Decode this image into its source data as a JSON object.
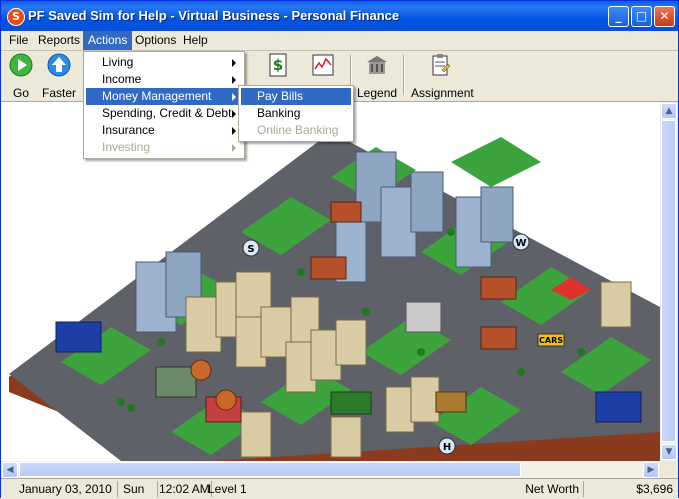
{
  "window": {
    "title": "PF Saved Sim for Help - Virtual Business - Personal Finance",
    "icon_letter": "S"
  },
  "menubar": [
    "File",
    "Reports",
    "Actions",
    "Options",
    "Help"
  ],
  "toolbar": {
    "go": "Go",
    "faster": "Faster",
    "legend": "Legend",
    "assignment": "Assignment"
  },
  "actions_menu": [
    {
      "label": "Living",
      "submenu": true,
      "enabled": true
    },
    {
      "label": "Income",
      "submenu": true,
      "enabled": true
    },
    {
      "label": "Money Management",
      "submenu": true,
      "enabled": true
    },
    {
      "label": "Spending, Credit & Debt",
      "submenu": true,
      "enabled": true
    },
    {
      "label": "Insurance",
      "submenu": true,
      "enabled": true
    },
    {
      "label": "Investing",
      "submenu": true,
      "enabled": false
    }
  ],
  "money_submenu": [
    {
      "label": "Pay Bills",
      "enabled": true
    },
    {
      "label": "Banking",
      "enabled": true
    },
    {
      "label": "Online Banking",
      "enabled": false
    }
  ],
  "map_markers": {
    "s": "S",
    "w": "W",
    "h": "H",
    "cars": "CARS"
  },
  "status": {
    "date": "January 03, 2010",
    "day": "Sun",
    "time": "12:02 AM",
    "level": "Level 1",
    "networth_label": "Net Worth",
    "networth_value": "$3,696"
  },
  "colors": {
    "title_blue": "#0055e5",
    "menu_highlight": "#316ac5",
    "road": "#5f6168",
    "grass": "#3da33d"
  }
}
